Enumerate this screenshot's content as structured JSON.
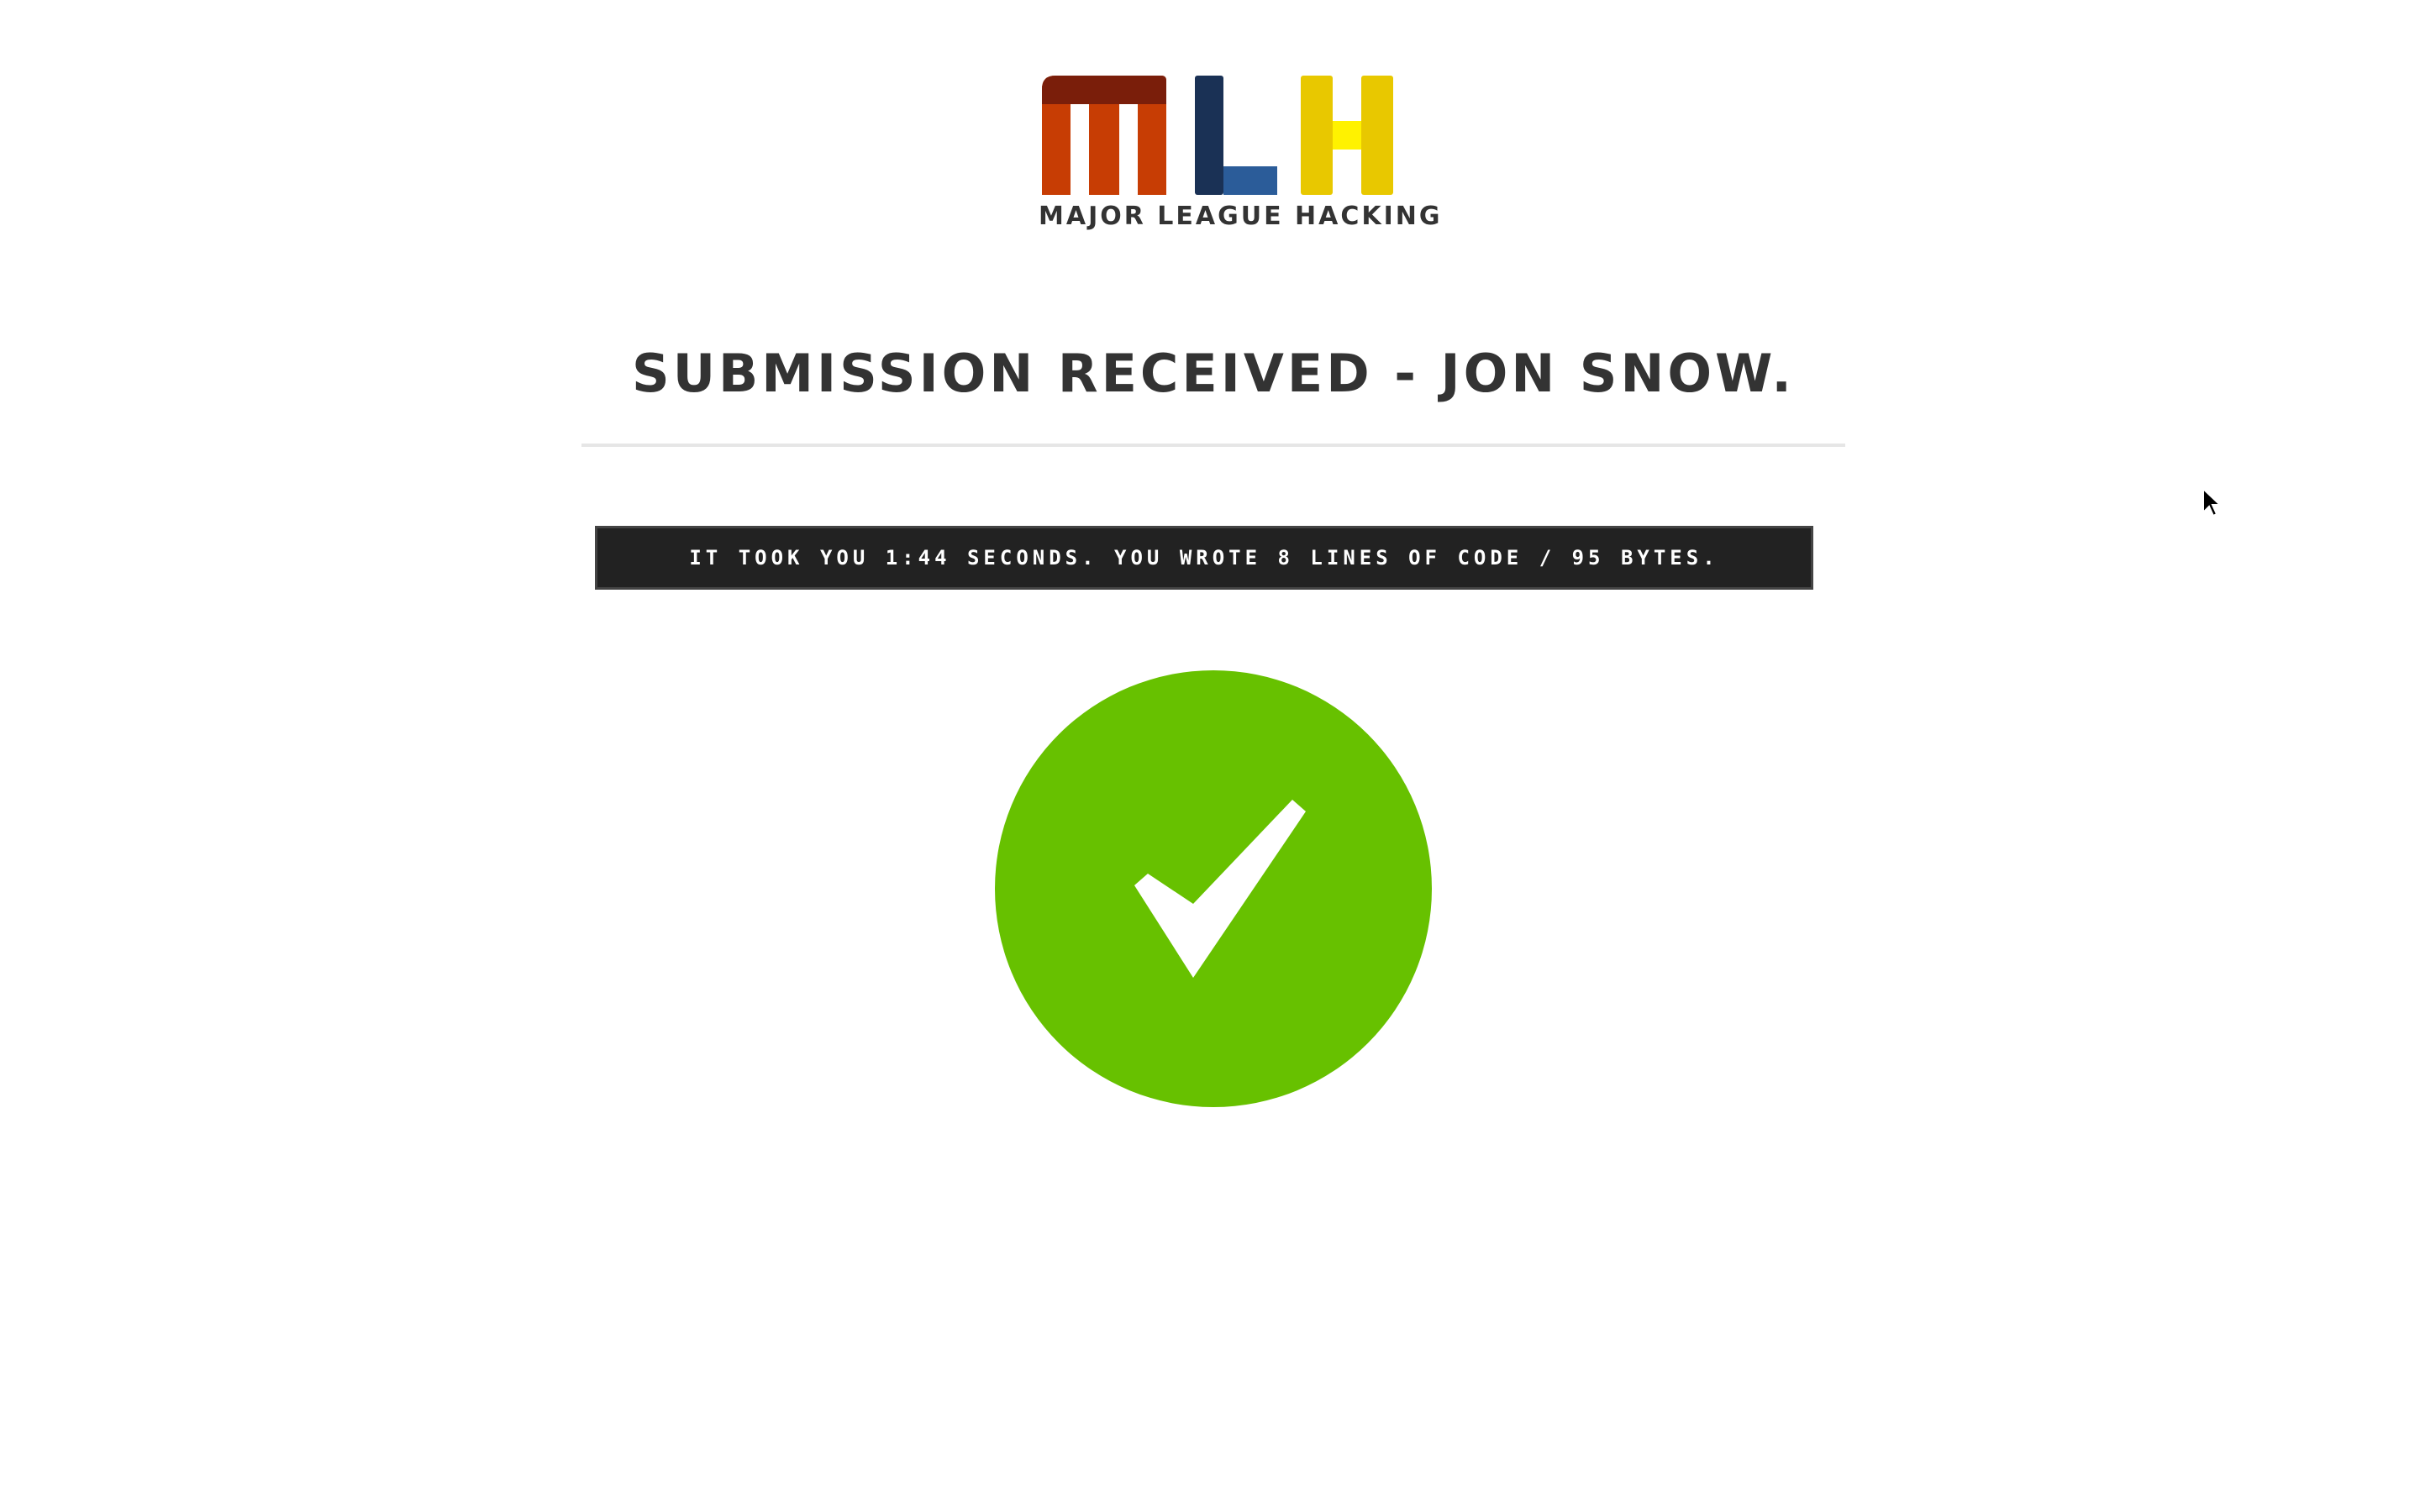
{
  "logo": {
    "wordmark": "MLH",
    "text": "MAJOR LEAGUE HACKING",
    "colors": {
      "m_top": "#7a1e0a",
      "m_body": "#c73d04",
      "l_dark": "#1a3155",
      "l_light": "#2b5c99",
      "h_body": "#e8c800",
      "h_bar": "#fff200"
    }
  },
  "page_title": "SUBMISSION RECEIVED - JON SNOW.",
  "stats": {
    "text": "IT TOOK YOU 1:44 SECONDS. YOU WROTE 8 LINES OF CODE / 95 BYTES."
  },
  "status": {
    "icon": "checkmark-icon",
    "color": "#67c100"
  }
}
